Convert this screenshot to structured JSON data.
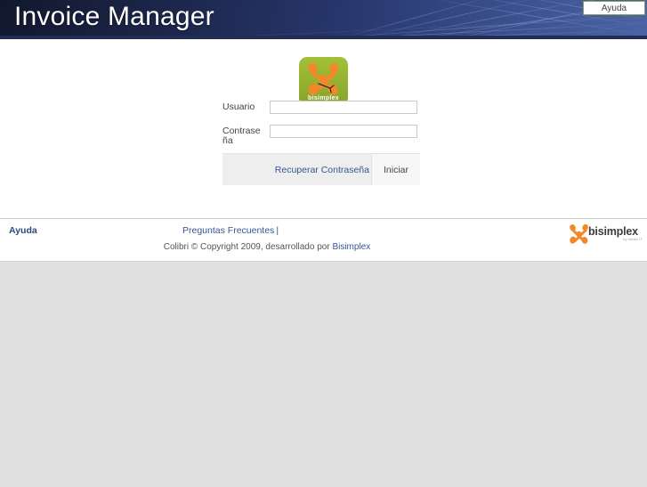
{
  "header": {
    "title": "Invoice Manager",
    "help_button": "Ayuda"
  },
  "brand": {
    "logo_wordmark": "bisimplex"
  },
  "login": {
    "username_label": "Usuario",
    "username_value": "",
    "username_placeholder": "",
    "password_label": "Contraseña",
    "password_value": "",
    "password_placeholder": "",
    "recover_link": "Recuperar Contraseña",
    "submit_label": "Iniciar"
  },
  "footer": {
    "help_label": "Ayuda",
    "faq_link": "Preguntas Frecuentes",
    "link_separator": "|",
    "copyright_prefix": "Colibri © Copyright 2009, desarrollado por ",
    "copyright_company": "Bisimplex",
    "logo_wordmark": "bisimplex",
    "logo_tagline": "by ideas IT"
  },
  "colors": {
    "header_dark": "#11182e",
    "header_light": "#4a63a5",
    "brand_green": "#93b02f",
    "brand_orange": "#f08a28",
    "link_blue": "#36568f",
    "page_gray": "#e0e0e0"
  }
}
